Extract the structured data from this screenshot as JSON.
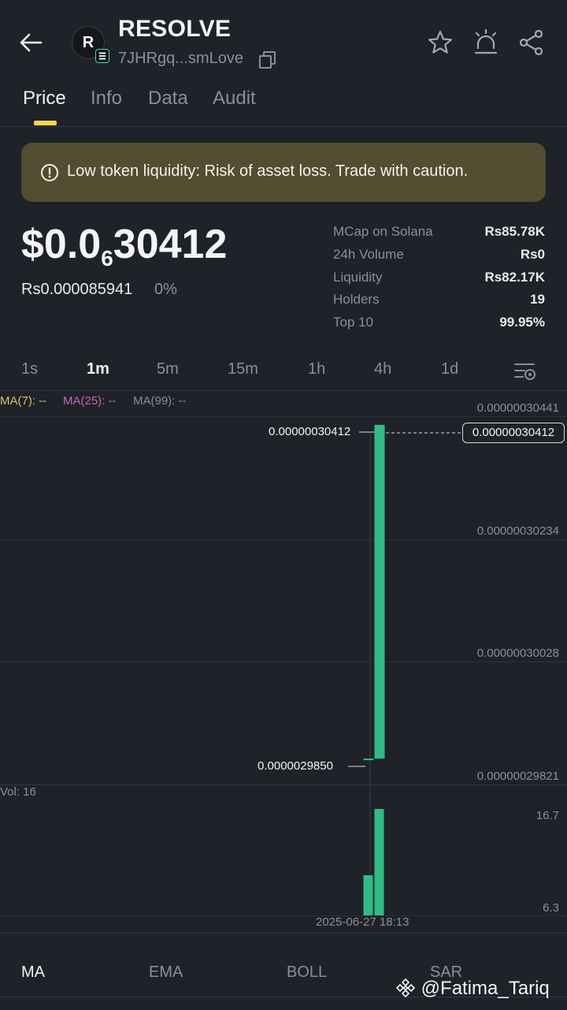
{
  "header": {
    "token_symbol": "RESOLVE",
    "avatar_letter": "R",
    "address": "7JHRgq...smLove"
  },
  "tabs": [
    {
      "label": "Price",
      "active": true
    },
    {
      "label": "Info",
      "active": false
    },
    {
      "label": "Data",
      "active": false
    },
    {
      "label": "Audit",
      "active": false
    }
  ],
  "warning": {
    "text": "Low token liquidity: Risk of asset loss. Trade with caution."
  },
  "price": {
    "prefix": "$0.0",
    "zero_count": "6",
    "digits": "30412",
    "local": "Rs0.000085941",
    "change": "0%"
  },
  "stats": [
    {
      "label": "MCap on Solana",
      "value": "Rs85.78K"
    },
    {
      "label": "24h Volume",
      "value": "Rs0"
    },
    {
      "label": "Liquidity",
      "value": "Rs82.17K"
    },
    {
      "label": "Holders",
      "value": "19"
    },
    {
      "label": "Top 10",
      "value": "99.95%"
    }
  ],
  "intervals": [
    "1s",
    "1m",
    "5m",
    "15m",
    "1h",
    "4h",
    "1d"
  ],
  "active_interval": "1m",
  "chart": {
    "ma_labels": [
      "MA(7): --",
      "MA(25): --",
      "MA(99): --"
    ],
    "y_ticks": [
      "0.00000030441",
      "0.00000030234",
      "0.00000030028",
      "0.00000029821"
    ],
    "high_label": "0.00000030412",
    "low_label": "0.0000029850",
    "last_price": "0.00000030412",
    "vol_label": "Vol: 16",
    "vol_ticks": [
      "16.7",
      "6.3"
    ],
    "time_label": "2025-06-27 18:13"
  },
  "chart_data": {
    "type": "candlestick",
    "y_range": [
      2.9821e-07,
      3.0441e-07
    ],
    "candles": [
      {
        "open": 2.985e-07,
        "close": 2.985e-07,
        "high": 2.985e-07,
        "low": 2.985e-07,
        "volume": 6.3
      },
      {
        "open": 2.985e-07,
        "close": 3.0412e-07,
        "high": 3.0412e-07,
        "low": 2.985e-07,
        "volume": 16.7
      }
    ],
    "volume_range": [
      0,
      16.7
    ]
  },
  "indicators": [
    {
      "label": "MA",
      "active": true
    },
    {
      "label": "EMA",
      "active": false
    },
    {
      "label": "BOLL",
      "active": false
    },
    {
      "label": "SAR",
      "active": false
    }
  ],
  "watermark": "@Fatima_Tariq",
  "colors": {
    "up": "#2fbd85",
    "accent": "#f5d64a",
    "warning_bg": "#534d32"
  }
}
